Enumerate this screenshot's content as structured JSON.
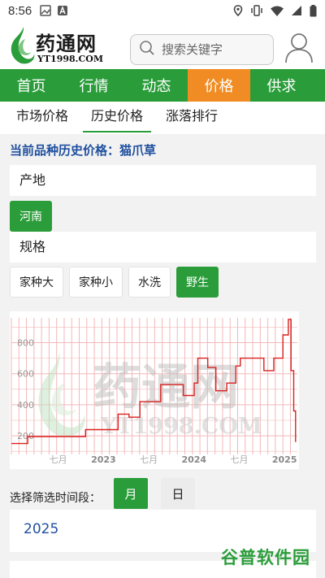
{
  "status": {
    "time": "8:56"
  },
  "header": {
    "logo_text": "药通网",
    "logo_site": "YT1998.COM",
    "search_placeholder": "搜索关键字"
  },
  "nav": {
    "tabs": [
      {
        "label": "首页",
        "active": false
      },
      {
        "label": "行情",
        "active": false
      },
      {
        "label": "动态",
        "active": false
      },
      {
        "label": "价格",
        "active": true
      },
      {
        "label": "供求",
        "active": false
      }
    ]
  },
  "subnav": {
    "tabs": [
      {
        "label": "市场价格",
        "active": false
      },
      {
        "label": "历史价格",
        "active": true
      },
      {
        "label": "涨落排行",
        "active": false
      }
    ]
  },
  "current_title": "当前品种历史价格：猫爪草",
  "origin": {
    "label": "产地",
    "options": [
      {
        "label": "河南",
        "selected": true
      }
    ]
  },
  "spec": {
    "label": "规格",
    "options": [
      {
        "label": "家种大",
        "selected": false
      },
      {
        "label": "家种小",
        "selected": false
      },
      {
        "label": "水洗",
        "selected": false
      },
      {
        "label": "野生",
        "selected": true
      }
    ]
  },
  "chart_data": {
    "type": "line",
    "watermark": "药通网 YT1998.COM",
    "yticks": [
      200,
      400,
      600,
      800
    ],
    "ylim": [
      80,
      960
    ],
    "xticks": [
      "七月",
      "2023",
      "七月",
      "2024",
      "七月",
      "2025"
    ],
    "xtick_pos": [
      0.5,
      1.0,
      1.5,
      2.0,
      2.5,
      3.0
    ],
    "xlim": [
      0.0,
      3.16
    ],
    "series_color": "#d9201f",
    "grid_color": "#f2b8b8",
    "points": [
      [
        0.0,
        150
      ],
      [
        0.18,
        150
      ],
      [
        0.18,
        195
      ],
      [
        0.82,
        195
      ],
      [
        0.82,
        240
      ],
      [
        1.18,
        240
      ],
      [
        1.18,
        340
      ],
      [
        1.3,
        340
      ],
      [
        1.3,
        320
      ],
      [
        1.42,
        320
      ],
      [
        1.42,
        420
      ],
      [
        1.65,
        420
      ],
      [
        1.65,
        530
      ],
      [
        1.9,
        530
      ],
      [
        1.9,
        460
      ],
      [
        2.02,
        460
      ],
      [
        2.02,
        540
      ],
      [
        2.06,
        540
      ],
      [
        2.06,
        700
      ],
      [
        2.17,
        700
      ],
      [
        2.17,
        640
      ],
      [
        2.26,
        640
      ],
      [
        2.26,
        490
      ],
      [
        2.38,
        490
      ],
      [
        2.38,
        540
      ],
      [
        2.48,
        540
      ],
      [
        2.48,
        650
      ],
      [
        2.53,
        650
      ],
      [
        2.53,
        700
      ],
      [
        2.79,
        700
      ],
      [
        2.79,
        620
      ],
      [
        2.9,
        620
      ],
      [
        2.9,
        700
      ],
      [
        3.0,
        700
      ],
      [
        3.0,
        850
      ],
      [
        3.06,
        850
      ],
      [
        3.06,
        950
      ],
      [
        3.09,
        950
      ],
      [
        3.09,
        620
      ],
      [
        3.12,
        620
      ],
      [
        3.12,
        360
      ],
      [
        3.14,
        360
      ],
      [
        3.14,
        160
      ]
    ]
  },
  "filter": {
    "label": "选择筛选时间段：",
    "options": [
      {
        "label": "月",
        "selected": true
      },
      {
        "label": "日",
        "selected": false
      }
    ]
  },
  "year": {
    "value": "2025"
  },
  "footer_watermark": "谷普软件园",
  "colors": {
    "green": "#2a9d3a",
    "orange": "#f08c23",
    "blue": "#1f4f9e"
  }
}
